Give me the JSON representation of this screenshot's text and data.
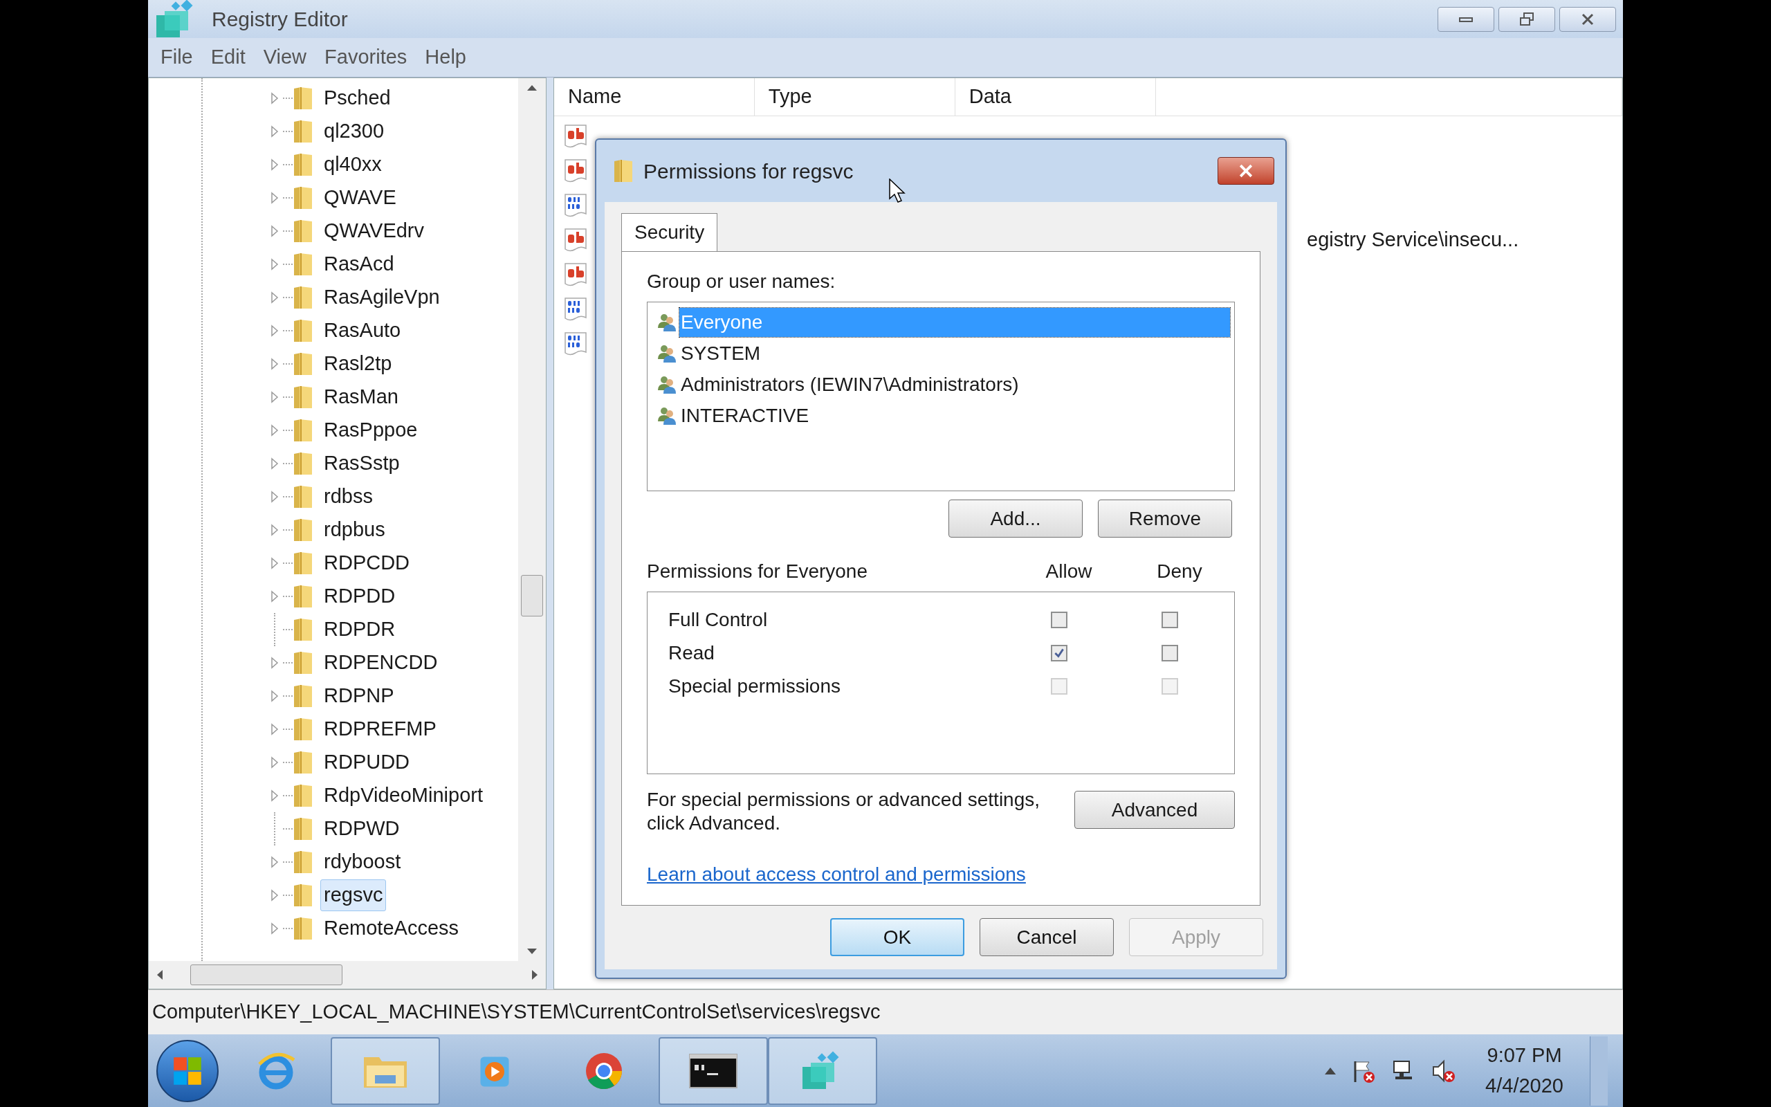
{
  "window": {
    "title": "Registry Editor"
  },
  "menu": [
    "File",
    "Edit",
    "View",
    "Favorites",
    "Help"
  ],
  "tree": {
    "items": [
      {
        "label": "Psched",
        "expandable": true,
        "selected": false
      },
      {
        "label": "ql2300",
        "expandable": true,
        "selected": false
      },
      {
        "label": "ql40xx",
        "expandable": true,
        "selected": false
      },
      {
        "label": "QWAVE",
        "expandable": true,
        "selected": false
      },
      {
        "label": "QWAVEdrv",
        "expandable": true,
        "selected": false
      },
      {
        "label": "RasAcd",
        "expandable": true,
        "selected": false
      },
      {
        "label": "RasAgileVpn",
        "expandable": true,
        "selected": false
      },
      {
        "label": "RasAuto",
        "expandable": true,
        "selected": false
      },
      {
        "label": "Rasl2tp",
        "expandable": true,
        "selected": false
      },
      {
        "label": "RasMan",
        "expandable": true,
        "selected": false
      },
      {
        "label": "RasPppoe",
        "expandable": true,
        "selected": false
      },
      {
        "label": "RasSstp",
        "expandable": true,
        "selected": false
      },
      {
        "label": "rdbss",
        "expandable": true,
        "selected": false
      },
      {
        "label": "rdpbus",
        "expandable": true,
        "selected": false
      },
      {
        "label": "RDPCDD",
        "expandable": true,
        "selected": false
      },
      {
        "label": "RDPDD",
        "expandable": true,
        "selected": false
      },
      {
        "label": "RDPDR",
        "expandable": false,
        "selected": false
      },
      {
        "label": "RDPENCDD",
        "expandable": true,
        "selected": false
      },
      {
        "label": "RDPNP",
        "expandable": true,
        "selected": false
      },
      {
        "label": "RDPREFMP",
        "expandable": true,
        "selected": false
      },
      {
        "label": "RDPUDD",
        "expandable": true,
        "selected": false
      },
      {
        "label": "RdpVideoMiniport",
        "expandable": true,
        "selected": false
      },
      {
        "label": "RDPWD",
        "expandable": false,
        "selected": false
      },
      {
        "label": "rdyboost",
        "expandable": true,
        "selected": false
      },
      {
        "label": "regsvc",
        "expandable": true,
        "selected": true
      },
      {
        "label": "RemoteAccess",
        "expandable": true,
        "selected": false
      }
    ]
  },
  "values": {
    "columns": [
      "Name",
      "Type",
      "Data"
    ],
    "rows": [
      {
        "kind": "string"
      },
      {
        "kind": "string"
      },
      {
        "kind": "binary"
      },
      {
        "kind": "string",
        "data": "egistry Service\\insecu..."
      },
      {
        "kind": "string"
      },
      {
        "kind": "binary"
      },
      {
        "kind": "binary"
      }
    ]
  },
  "dialog": {
    "title": "Permissions for regsvc",
    "tabs": [
      {
        "label": "Security",
        "selected": true
      }
    ],
    "group_label": "Group or user names:",
    "users": [
      {
        "name": "Everyone",
        "selected": true
      },
      {
        "name": "SYSTEM",
        "selected": false
      },
      {
        "name": "Administrators (IEWIN7\\Administrators)",
        "selected": false
      },
      {
        "name": "INTERACTIVE",
        "selected": false
      }
    ],
    "user_buttons": [
      "Add...",
      "Remove"
    ],
    "permissions_label": "Permissions for Everyone",
    "allow_label": "Allow",
    "deny_label": "Deny",
    "permissions": [
      {
        "name": "Full Control",
        "allow": false,
        "deny": false,
        "disabled": false
      },
      {
        "name": "Read",
        "allow": true,
        "deny": false,
        "disabled": false
      },
      {
        "name": "Special permissions",
        "allow": false,
        "deny": false,
        "disabled": true
      }
    ],
    "advanced_note": "For special permissions or advanced settings, click Advanced.",
    "advanced_button": "Advanced",
    "link": "Learn about access control and permissions",
    "footer_buttons": [
      {
        "label": "OK",
        "kind": "default"
      },
      {
        "label": "Cancel",
        "kind": "normal"
      },
      {
        "label": "Apply",
        "kind": "disabled"
      }
    ]
  },
  "status_bar": "Computer\\HKEY_LOCAL_MACHINE\\SYSTEM\\CurrentControlSet\\services\\regsvc",
  "taskbar": {
    "apps": [
      {
        "kind": "browser-e",
        "running": false
      },
      {
        "kind": "folder",
        "running": true
      },
      {
        "kind": "player",
        "running": false
      },
      {
        "kind": "chrome",
        "running": false
      },
      {
        "kind": "console",
        "running": true
      },
      {
        "kind": "registry",
        "running": true
      }
    ],
    "time": "9:07 PM",
    "date": "4/4/2020"
  }
}
